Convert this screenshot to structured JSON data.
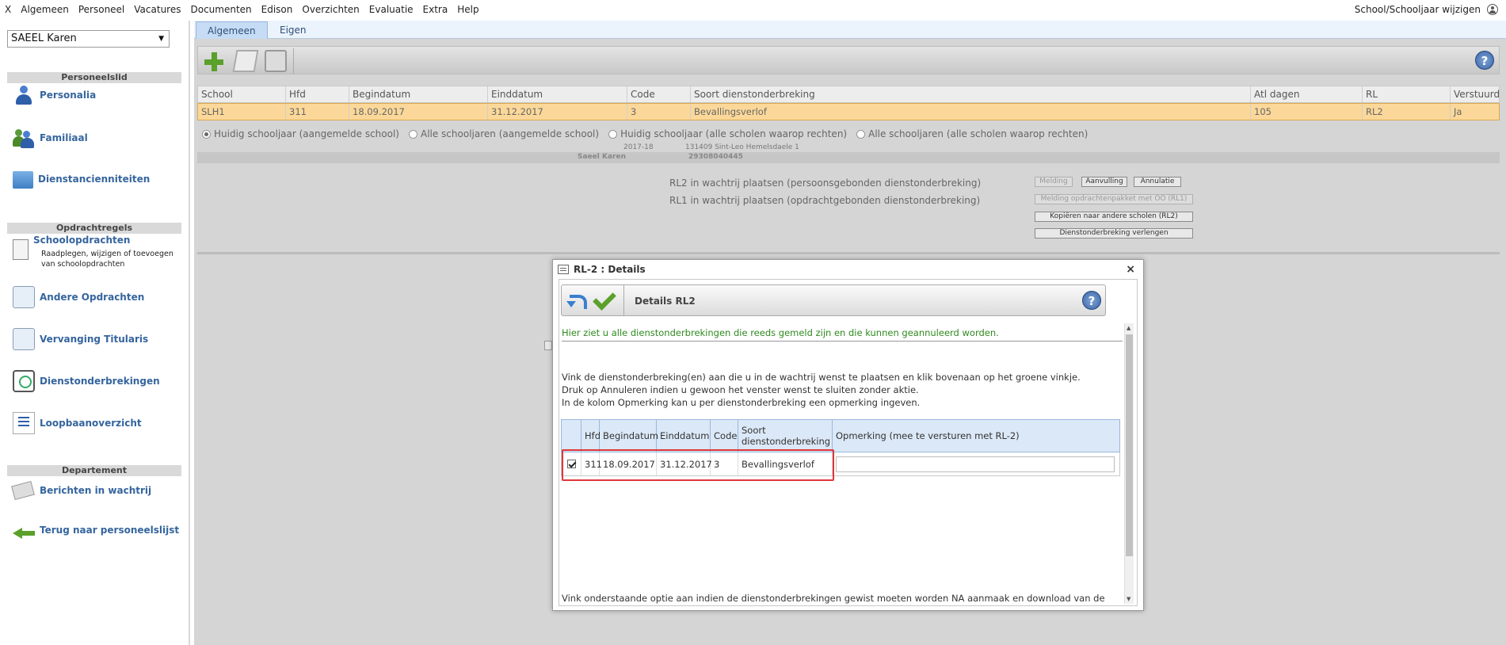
{
  "menu": {
    "close": "X",
    "items": [
      "Algemeen",
      "Personeel",
      "Vacatures",
      "Documenten",
      "Edison",
      "Overzichten",
      "Evaluatie",
      "Extra",
      "Help"
    ],
    "right_label": "School/Schooljaar wijzigen"
  },
  "sidebar": {
    "selected_person": "SAEEL Karen",
    "sections": [
      "Personeelslid",
      "Opdrachtregels",
      "Departement"
    ],
    "items": [
      {
        "label": "Personalia",
        "icon": "person-icon"
      },
      {
        "label": "Familiaal",
        "icon": "family-icon"
      },
      {
        "label": "Dienstancienniteiten",
        "icon": "folder-icon"
      },
      {
        "label": "Schoolopdrachten",
        "icon": "clipboard-icon",
        "sub": "Raadplegen, wijzigen of toevoegen van schoolopdrachten"
      },
      {
        "label": "Andere Opdrachten",
        "icon": "hand-icon"
      },
      {
        "label": "Vervanging Titularis",
        "icon": "swap-icon"
      },
      {
        "label": "Dienstonderbrekingen",
        "icon": "clock-icon"
      },
      {
        "label": "Loopbaanoverzicht",
        "icon": "checklist-icon"
      },
      {
        "label": "Berichten in wachtrij",
        "icon": "envelope-icon"
      },
      {
        "label": "Terug naar personeelslijst",
        "icon": "back-arrow-icon"
      }
    ]
  },
  "tabs": [
    "Algemeen",
    "Eigen"
  ],
  "grid": {
    "headers": [
      "School",
      "Hfd",
      "Begindatum",
      "Einddatum",
      "Code",
      "Soort dienstonderbreking",
      "Atl dagen",
      "RL",
      "Verstuurd"
    ],
    "row": [
      "SLH1",
      "311",
      "18.09.2017",
      "31.12.2017",
      "3",
      "Bevallingsverlof",
      "105",
      "RL2",
      "Ja"
    ]
  },
  "radios": [
    {
      "label": "Huidig schooljaar (aangemelde school)",
      "checked": true
    },
    {
      "label": "Alle schooljaren (aangemelde school)",
      "checked": false
    },
    {
      "label": "Huidig schooljaar (alle scholen waarop rechten)",
      "checked": false
    },
    {
      "label": "Alle schooljaren (alle scholen waarop rechten)",
      "checked": false
    }
  ],
  "info": {
    "year": "2017-18",
    "school": "131409 Sint-Leo Hemelsdaele 1",
    "name": "Saeel Karen",
    "number": "29308040445"
  },
  "rl": {
    "rl2_text": "RL2 in wachtrij plaatsen (persoonsgebonden dienstonderbreking)",
    "rl1_text": "RL1 in wachtrij plaatsen (opdrachtgebonden dienstonderbreking)",
    "btn_melding": "Melding",
    "btn_aanvulling": "Aanvulling",
    "btn_annulatie": "Annulatie",
    "btn_melding_oo": "Melding opdrachtenpakket met OO (RL1)",
    "btn_kopieren": "Kopiëren naar andere scholen (RL2)",
    "btn_verlengen": "Dienstonderbreking verlengen"
  },
  "dialog": {
    "title": "RL-2 : Details",
    "close": "×",
    "header": "Details RL2",
    "help": "?",
    "green_text": "Hier ziet u alle dienstonderbrekingen die reeds gemeld zijn en die kunnen geannuleerd worden.",
    "instr1": "Vink de dienstonderbreking(en) aan die u in de wachtrij wenst te plaatsen en klik bovenaan op het groene vinkje.",
    "instr2": "Druk op Annuleren indien u gewoon het venster wenst te sluiten zonder aktie.",
    "instr3": "In de kolom Opmerking kan u per dienstonderbreking een opmerking ingeven.",
    "table_headers": [
      "",
      "Hfd",
      "Begindatum",
      "Einddatum",
      "Code",
      "Soort dienstonderbreking",
      "Opmerking (mee te versturen met RL-2)"
    ],
    "row": {
      "checked": true,
      "hfd": "311",
      "begin": "18.09.2017",
      "eind": "31.12.2017",
      "code": "3",
      "soort": "Bevallingsverlof",
      "opmerking": ""
    },
    "footnote": "Vink onderstaande optie aan indien de dienstonderbrekingen gewist moeten worden NA aanmaak en download van de"
  },
  "colors": {
    "accent": "#35659e",
    "selected_row": "#fbd899",
    "highlight": "#e0363b",
    "green": "#2f8a1f"
  }
}
